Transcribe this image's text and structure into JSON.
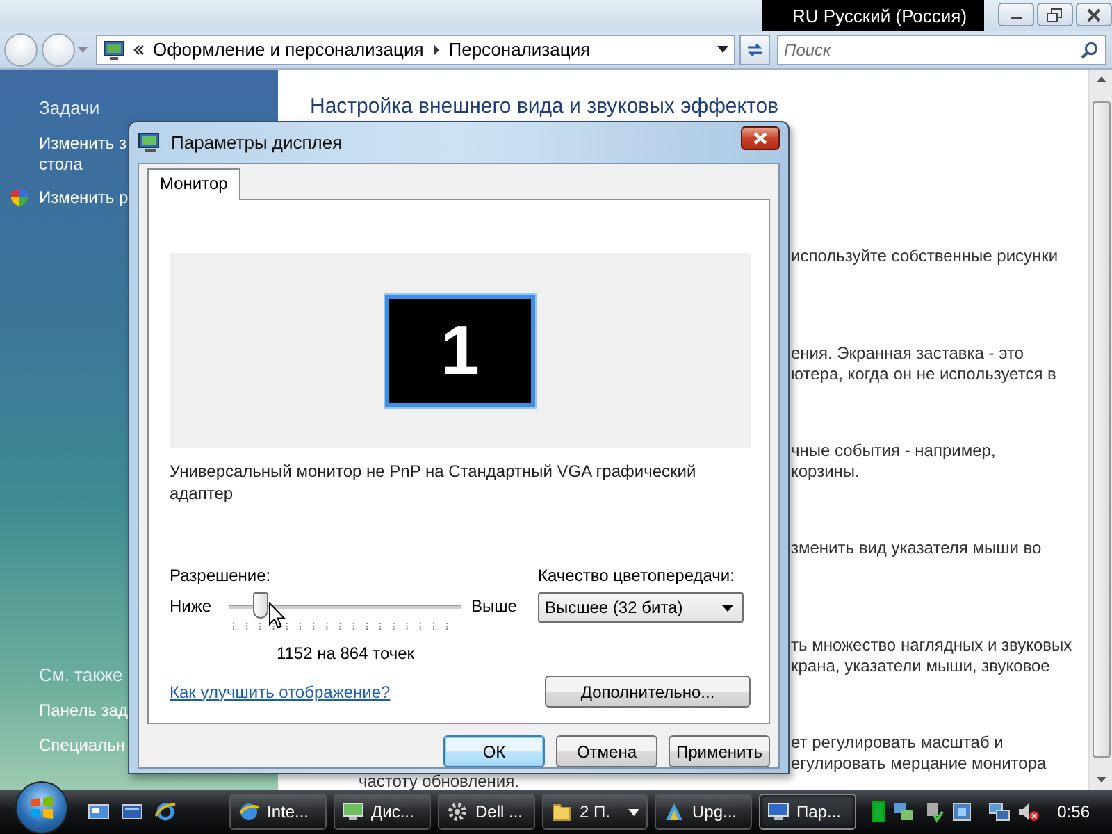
{
  "explorer": {
    "language_bar": "RU Русский (Россия)",
    "address": {
      "breadcrumbs": [
        "Оформление и персонализация",
        "Персонализация"
      ]
    },
    "search": {
      "placeholder": "Поиск"
    },
    "sidebar": {
      "tasks_title": "Задачи",
      "tasks": [
        {
          "kind": "plain",
          "lines": [
            "Изменить з",
            "стола"
          ]
        },
        {
          "kind": "shield",
          "lines": [
            "Изменить р"
          ]
        }
      ],
      "see_also_title": "См. также",
      "see_also": [
        "Панель зад",
        "Специальн"
      ]
    },
    "heading": "Настройка внешнего вида и звуковых эффектов",
    "sections": [
      {
        "lines": [
          "используйте собственные рисунки"
        ]
      },
      {
        "lines": [
          "ения. Экранная заставка - это",
          "ютера, когда он не используется в"
        ]
      },
      {
        "lines": [
          "чные события - например,",
          "корзины."
        ]
      },
      {
        "lines": [
          "зменить вид указателя мыши во"
        ]
      },
      {
        "lines": [
          "ть множество наглядных и звуковых",
          "крана, указатели мыши, звуковое"
        ]
      },
      {
        "lines": [
          "ет регулировать масштаб и",
          "егулировать мерцание монитора"
        ],
        "tail": "частоту обновления."
      }
    ]
  },
  "dialog": {
    "title": "Параметры дисплея",
    "tabs": [
      {
        "label": "Монитор",
        "selected": true
      }
    ],
    "monitor_number": "1",
    "description": "Универсальный монитор не PnP на Стандартный VGA графический адаптер",
    "resolution": {
      "label": "Разрешение:",
      "low": "Ниже",
      "high": "Выше",
      "level": 0.13,
      "reading": "1152 на 864 точек"
    },
    "color_quality": {
      "label": "Качество цветопередачи:",
      "value": "Высшее (32 бита)"
    },
    "help_link": "Как улучшить отображение?",
    "advanced_button": "Дополнительно...",
    "buttons": [
      {
        "label": "ОК",
        "default": true
      },
      {
        "label": "Отмена",
        "default": false
      },
      {
        "label": "Применить",
        "default": false
      }
    ]
  },
  "taskbar": {
    "tasks": [
      {
        "label": "Inte...",
        "selected": false,
        "grouped": false
      },
      {
        "label": "Дис...",
        "selected": false,
        "grouped": false
      },
      {
        "label": "Dell ...",
        "selected": false,
        "grouped": false
      },
      {
        "label": "2 П.",
        "selected": false,
        "grouped": true
      },
      {
        "label": "Upg...",
        "selected": false,
        "grouped": false
      },
      {
        "label": "Пар...",
        "selected": true,
        "grouped": false
      }
    ],
    "clock": "0:56"
  }
}
